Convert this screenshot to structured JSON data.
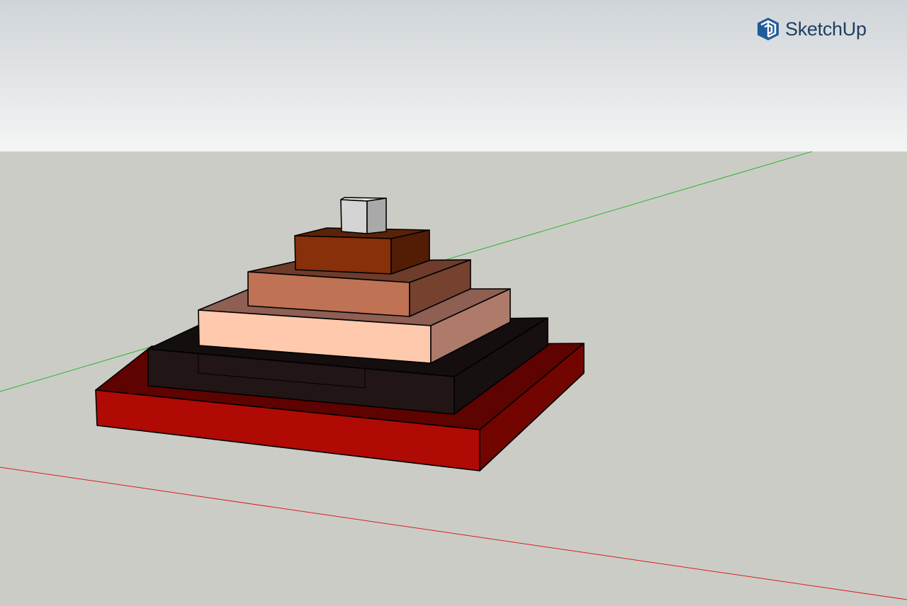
{
  "app": {
    "logo_text": "SketchUp",
    "logo_icon": "sketchup-logo-icon"
  },
  "viewport": {
    "axes": {
      "green_axis": "green-axis-line",
      "red_axis": "red-axis-line"
    },
    "model": {
      "name": "stacked-pyramid",
      "layers": [
        {
          "name": "base-slab",
          "front": "#B00A05",
          "side": "#720500",
          "top": "#5E0300"
        },
        {
          "name": "black-layer",
          "front": "#221515",
          "side": "#161010",
          "top": "#150E0E"
        },
        {
          "name": "peach-layer",
          "front": "#FFC9AE",
          "side": "#AE7B6B",
          "top": "#8F5F54"
        },
        {
          "name": "salmon-layer",
          "front": "#C07254",
          "side": "#74422F",
          "top": "#6E3C2B"
        },
        {
          "name": "brown-layer",
          "front": "#87300A",
          "side": "#521C05",
          "top": "#5A2308"
        },
        {
          "name": "gray-cube",
          "front": "#D4D4D4",
          "side": "#A9A9A9",
          "top": "#EFEFEF"
        }
      ]
    }
  },
  "colors": {
    "sky_top": "#CFD4D8",
    "sky_bottom": "#F4F5F5",
    "ground": "#CCCCC7",
    "logo_blue": "#1F5C99",
    "logo_text": "#1E3E5E",
    "green_axis": "#2BB52B",
    "red_axis": "#D62020",
    "edge": "#000000"
  }
}
